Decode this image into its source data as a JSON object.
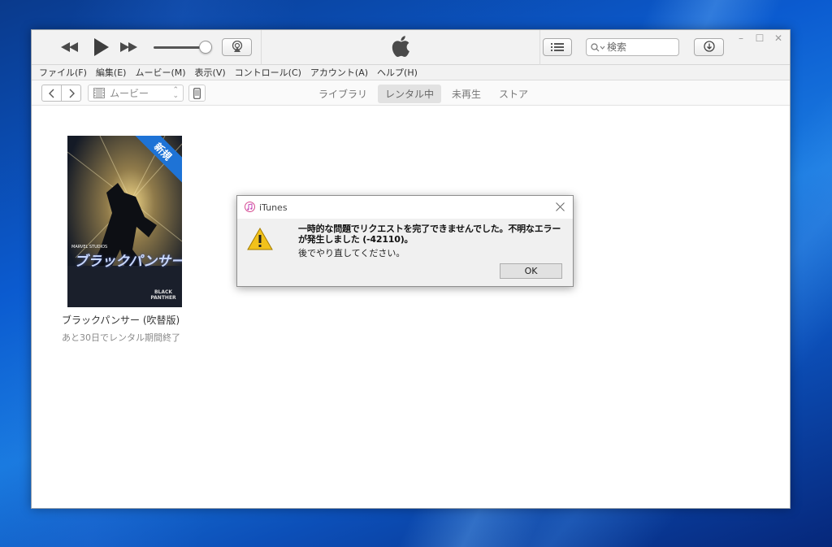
{
  "app": {
    "brand_icon": "apple-logo-icon"
  },
  "toolbar": {
    "search_placeholder": "検索",
    "icons": [
      "rewind-icon",
      "play-icon",
      "fast-forward-icon",
      "airplay-icon",
      "list-icon",
      "search-icon",
      "download-icon"
    ],
    "volume_level": 0.85
  },
  "window_controls": {
    "minimize": "–",
    "maximize": "☐",
    "close": "✕"
  },
  "menu": {
    "items": [
      "ファイル(F)",
      "編集(E)",
      "ムービー(M)",
      "表示(V)",
      "コントロール(C)",
      "アカウント(A)",
      "ヘルプ(H)"
    ]
  },
  "nav": {
    "media_kind": "ムービー",
    "tabs": [
      {
        "label": "ライブラリ",
        "active": false
      },
      {
        "label": "レンタル中",
        "active": true
      },
      {
        "label": "未再生",
        "active": false
      },
      {
        "label": "ストア",
        "active": false
      }
    ]
  },
  "movie": {
    "badge": "新規",
    "poster_title": "ブラックパンサー",
    "poster_brand": "MARVEL STUDIOS",
    "poster_logo": "BLACK PANTHER",
    "title": "ブラックパンサー (吹替版)",
    "rental_note": "あと30日でレンタル期間終了"
  },
  "dialog": {
    "title": "iTunes",
    "message_line1": "一時的な問題でリクエストを完了できませんでした。不明なエラーが発生しました (-42110)。",
    "message_line2": "後でやり直してください。",
    "ok_label": "OK"
  },
  "colors": {
    "desktop": "#0b5bd0",
    "toolbar_bg": "#f2f2f2",
    "active_tab_bg": "#e2e2e2",
    "badge": "#1e73d6",
    "warning": "#f2c21b"
  }
}
